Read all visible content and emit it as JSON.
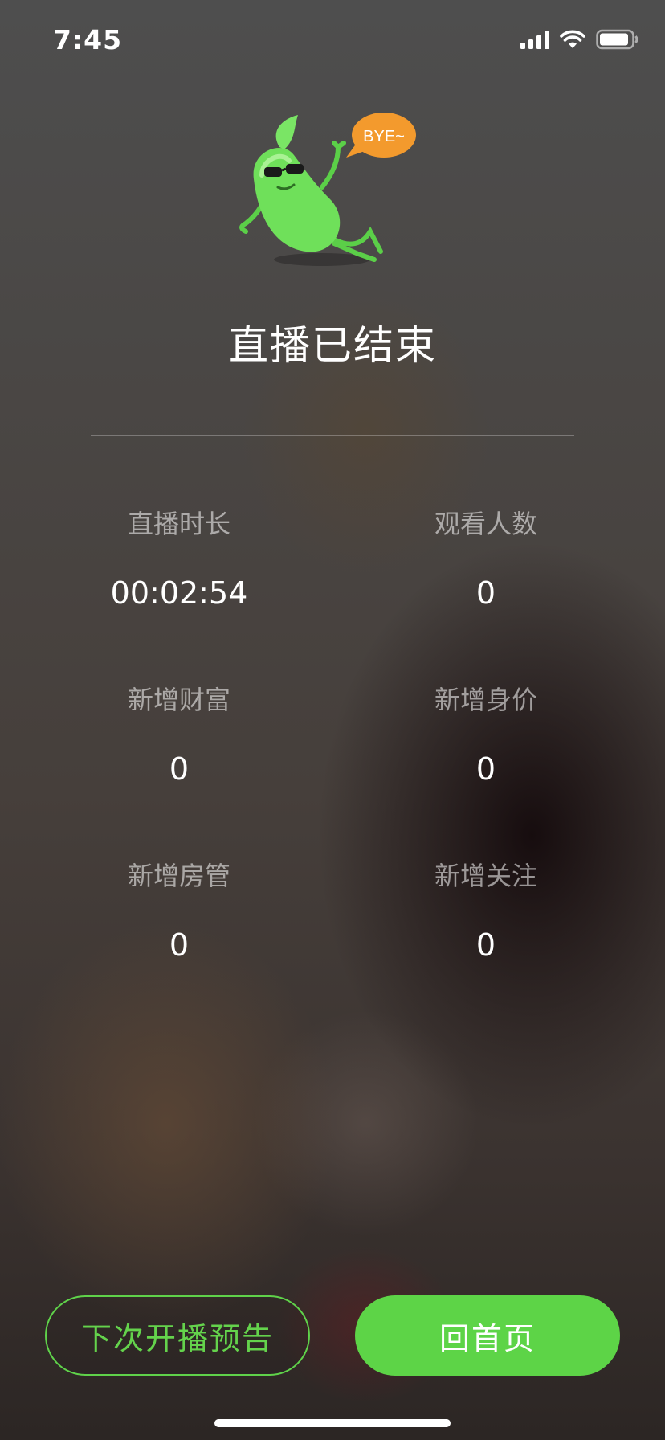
{
  "status_bar": {
    "time": "7:45",
    "icons": [
      "signal-icon",
      "wifi-icon",
      "battery-icon"
    ]
  },
  "mascot": {
    "bubble_text": "BYE~",
    "colors": {
      "bean": "#6fe05a",
      "bubble": "#f39a2d"
    }
  },
  "title": "直播已结束",
  "stats": [
    {
      "label": "直播时长",
      "value": "00:02:54"
    },
    {
      "label": "观看人数",
      "value": "0"
    },
    {
      "label": "新增财富",
      "value": "0"
    },
    {
      "label": "新增身价",
      "value": "0"
    },
    {
      "label": "新增房管",
      "value": "0"
    },
    {
      "label": "新增关注",
      "value": "0"
    }
  ],
  "buttons": {
    "preview_label": "下次开播预告",
    "home_label": "回首页"
  },
  "colors": {
    "accent": "#5dd447"
  }
}
